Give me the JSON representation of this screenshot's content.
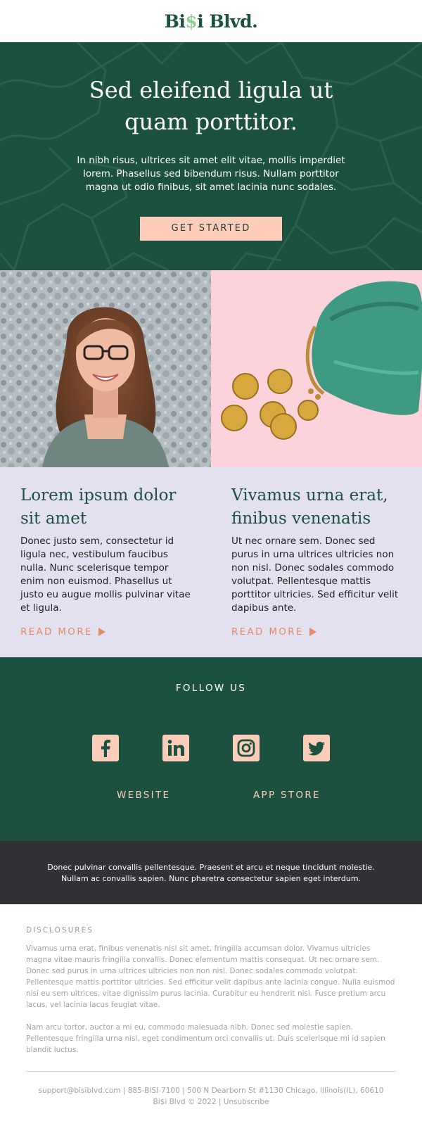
{
  "brand": {
    "logo_pre": "Bi",
    "logo_dollar": "$",
    "logo_post": "i Blvd."
  },
  "hero": {
    "title": "Sed eleifend ligula ut quam porttitor.",
    "body": "In nibh risus, ultrices sit amet elit vitae, mollis imperdiet lorem. Phasellus sed bibendum risus. Nullam porttitor magna ut odio finibus, sit amet lacinia nunc sodales.",
    "cta_label": "GET STARTED"
  },
  "photos": [
    {
      "name": "woman-with-glasses-photo"
    },
    {
      "name": "green-coin-purse-photo"
    }
  ],
  "cards": [
    {
      "title": "Lorem ipsum dolor sit amet",
      "body": "Donec justo sem, consectetur id ligula nec, vestibulum faucibus nulla. Nunc scelerisque tempor enim non euismod. Phasellus ut justo eu augue mollis pulvinar vitae et ligula.",
      "link_label": "READ MORE"
    },
    {
      "title": "Vivamus urna erat, finibus venenatis",
      "body": "Ut nec ornare sem. Donec sed purus in urna ultrices ultricies non non nisl. Donec sodales commodo volutpat. Pellentesque mattis porttitor ultricies. Sed efficitur velit dapibus ante.",
      "link_label": "READ MORE"
    }
  ],
  "follow": {
    "title": "FOLLOW US",
    "icons": [
      "facebook-icon",
      "linkedin-icon",
      "instagram-icon",
      "twitter-icon"
    ],
    "website_label": "WEBSITE",
    "app_store_label": "APP STORE"
  },
  "note": {
    "line1": "Donec pulvinar convallis pellentesque. Praesent et arcu et neque tincidunt molestie.",
    "line2": "Nullam ac convallis sapien. Nunc pharetra consectetur sapien eget interdum."
  },
  "disclosures": {
    "title": "DISCLOSURES",
    "p1": "Vivamus urna erat, finibus venenatis nisl sit amet, fringilla accumsan dolor. Vivamus ultricies magna vitae mauris fringilla convallis. Donec elementum mattis consequat. Ut nec ornare sem. Donec sed purus in urna ultrices ultricies non non nisl. Donec sodales commodo volutpat. Pellentesque mattis porttitor ultricies. Sed efficitur velit dapibus ante lacinia congue. Nulla euismod nisi eu sem ultrices, vitae dignissim purus lacinia. Curabitur eu hendrerit nisi. Fusce pretium arcu lacus, vel lacinia lacus feugiat vitae.",
    "p2": "Nam arcu tortor, auctor a mi eu, commodo malesuada nibh. Donec sed molestie sapien. Pellentesque fringilla urna nisl, eget condimentum orci convallis ut. Duis scelerisque mi id sapien blandit luctus."
  },
  "footer": {
    "contact": "support@bisiblvd.com | 885-BISI-7100 | 500 N Dearborn St #1130 Chicago, Illinois(IL), 60610",
    "copyright_pre": "Bi$i Blvd © 2022 | ",
    "unsubscribe_label": "Unsubscribe"
  },
  "colors": {
    "brand_green": "#1c5140",
    "peach": "#fdcdb9",
    "lavender": "#e3e1f0",
    "coral": "#e4896a",
    "charcoal": "#313236"
  }
}
